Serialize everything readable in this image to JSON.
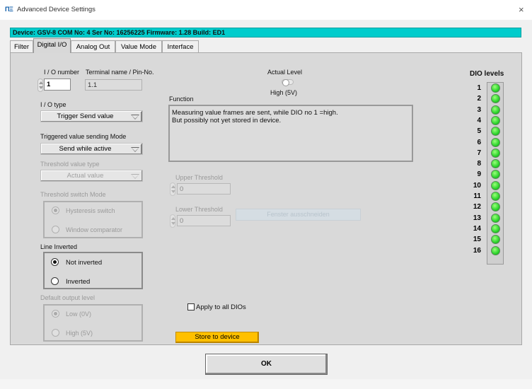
{
  "window": {
    "logo": "ΠΞ",
    "title": "Advanced Device Settings",
    "close_glyph": "×"
  },
  "device_bar": "Device: GSV-8 COM No: 4 Ser No: 16256225 Firmware: 1.28 Build: ED1",
  "tabs": [
    {
      "label": "Filter",
      "active": false
    },
    {
      "label": "Digital I/O",
      "active": true
    },
    {
      "label": "Analog Out",
      "active": false
    },
    {
      "label": "Value Mode",
      "active": false
    },
    {
      "label": "Interface",
      "active": false
    }
  ],
  "io": {
    "number_label": "I / O number",
    "number_value": "1",
    "terminal_label": "Terminal name / Pin-No.",
    "terminal_value": "1.1",
    "type_label": "I / O type",
    "type_value": "Trigger Send value",
    "trig_mode_label": "Triggered value sending Mode",
    "trig_mode_value": "Send while active",
    "threshold_type_label": "Threshold value type",
    "threshold_type_value": "Actual value",
    "threshold_switch_label": "Threshold switch Mode",
    "threshold_switch_options": [
      "Hysteresis switch",
      "Window comparator"
    ],
    "threshold_switch_selected": 0,
    "line_inverted_label": "Line Inverted",
    "line_inverted_options": [
      "Not inverted",
      "Inverted"
    ],
    "line_inverted_selected": 0,
    "default_output_label": "Default output level",
    "default_output_options": [
      "Low (0V)",
      "High (5V)"
    ],
    "default_output_selected": 0
  },
  "actual_level": {
    "label": "Actual Level",
    "value": "High (5V)"
  },
  "function": {
    "label": "Function",
    "text_line1": "Measuring value frames are sent, while DIO no 1 =high.",
    "text_line2": "But possibly not yet stored in device."
  },
  "thresholds": {
    "upper_label": "Upper Threshold",
    "upper_value": "0",
    "lower_label": "Lower Threshold",
    "lower_value": "0",
    "fenster_button": "Fenster ausschneiden"
  },
  "apply_all_label": "Apply to all DIOs",
  "apply_all_checked": false,
  "store_button": "Store to device",
  "ok_button": "OK",
  "dio_levels": {
    "title": "DIO levels",
    "items": [
      "1",
      "2",
      "3",
      "4",
      "5",
      "6",
      "7",
      "8",
      "9",
      "10",
      "11",
      "12",
      "13",
      "14",
      "15",
      "16"
    ],
    "led_color": "#2cd42c"
  }
}
